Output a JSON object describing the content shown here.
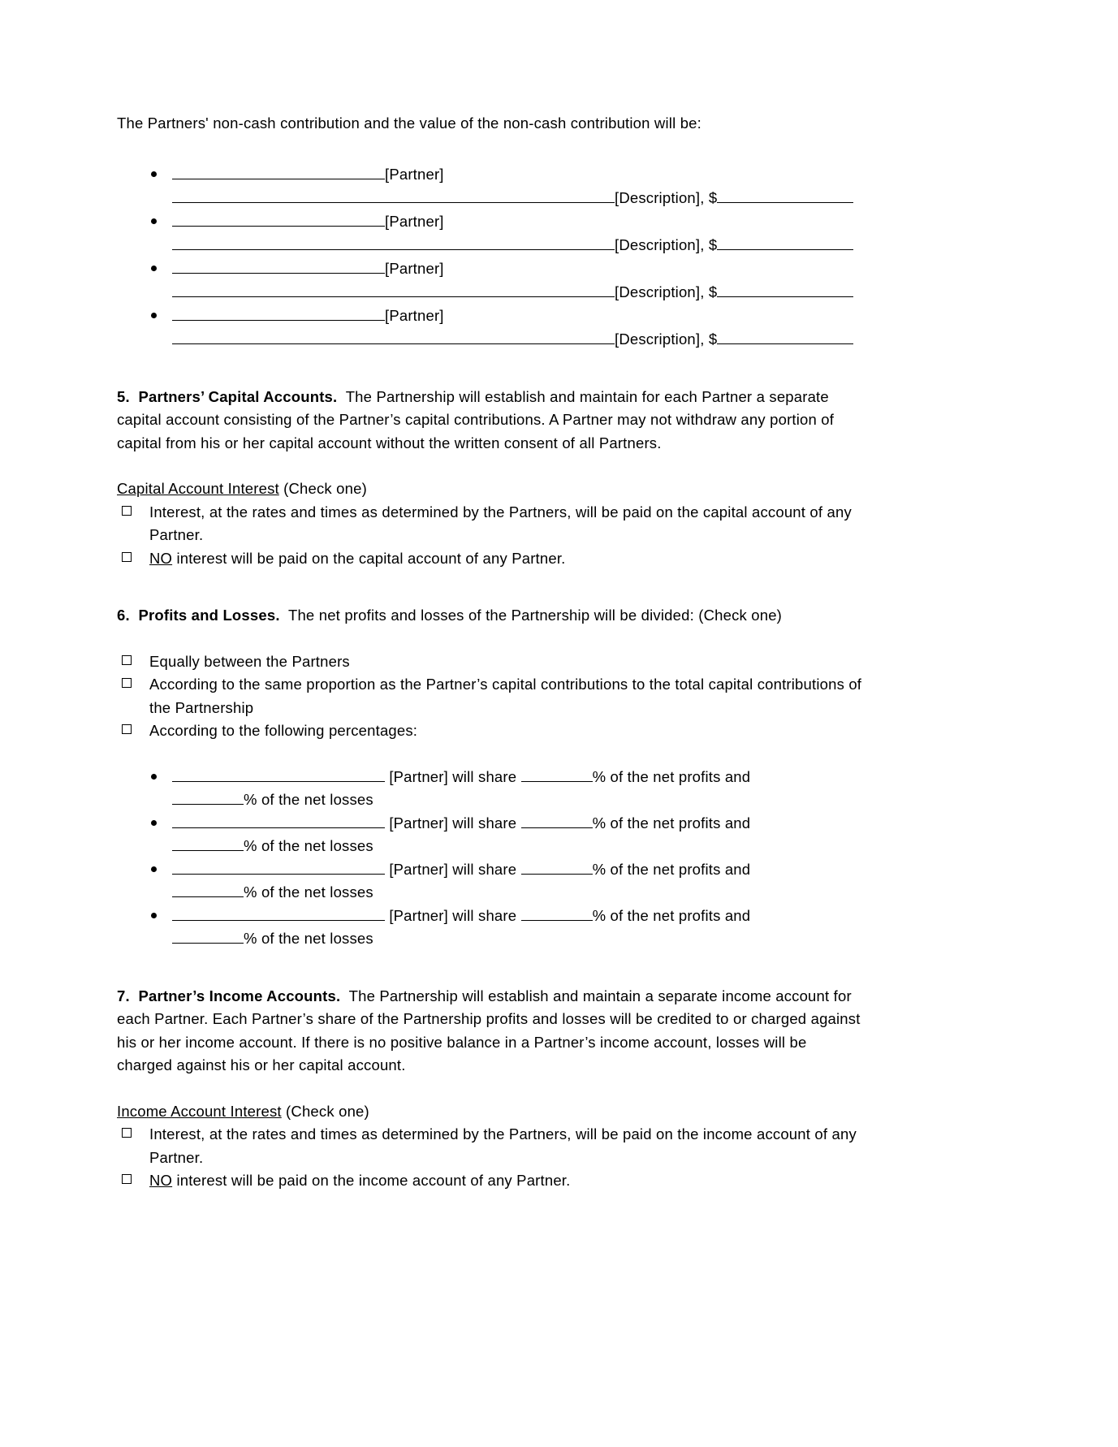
{
  "document": {
    "intro": "The Partners' non-cash contribution and the value of the non-cash contribution will be:",
    "contribution_entries": [
      {
        "partner_label": "[Partner]",
        "description_label": "[Description], $"
      },
      {
        "partner_label": "[Partner]",
        "description_label": "[Description], $"
      },
      {
        "partner_label": "[Partner]",
        "description_label": "[Description], $"
      },
      {
        "partner_label": "[Partner]",
        "description_label": "[Description], $"
      }
    ],
    "section5": {
      "number": "5.",
      "heading": "Partners’ Capital Accounts.",
      "body": "The Partnership will establish and maintain for each Partner a separate capital account consisting of the Partner’s capital contributions. A Partner may not withdraw any portion of capital from his or her capital account without the written consent of all Partners.",
      "interest_heading": "Capital Account Interest",
      "interest_heading_suffix": " (Check one)",
      "options": [
        {
          "text": "Interest, at the rates and times as determined by the Partners, will be paid on the capital account of any Partner.",
          "checked": false
        },
        {
          "emphasis": "NO",
          "text": " interest will be paid on the capital account of any Partner.",
          "checked": false
        }
      ]
    },
    "section6": {
      "number": "6.",
      "heading": "Profits and Losses.",
      "body": "The net profits and losses of the Partnership will be divided: (Check one)",
      "options": [
        {
          "text": "Equally between the Partners",
          "checked": false
        },
        {
          "text": "According to the same proportion as the Partner’s capital contributions to the total capital contributions of the Partnership",
          "checked": false
        },
        {
          "text": "According to the following percentages:",
          "checked": false
        }
      ],
      "percentage_entries": [
        {
          "partner_label": "[Partner] will share",
          "profits_suffix": "% of the net profits and",
          "losses_suffix": "% of the net losses"
        },
        {
          "partner_label": "[Partner] will share",
          "profits_suffix": "% of the net profits and",
          "losses_suffix": "% of the net losses"
        },
        {
          "partner_label": "[Partner] will share",
          "profits_suffix": "% of the net profits and",
          "losses_suffix": "% of the net losses"
        },
        {
          "partner_label": "[Partner] will share",
          "profits_suffix": "% of the net profits and",
          "losses_suffix": "% of the net losses"
        }
      ]
    },
    "section7": {
      "number": "7.",
      "heading": "Partner’s Income Accounts.",
      "body": "The Partnership will establish and maintain a separate income account for each Partner. Each Partner’s share of the Partnership profits and losses will be credited to or charged against his or her income account. If there is no positive balance in a Partner’s income account, losses will be charged against his or her capital account.",
      "interest_heading": "Income Account Interest",
      "interest_heading_suffix": " (Check one)",
      "options": [
        {
          "text": "Interest, at the rates and times as determined by the Partners, will be paid on the income account of any Partner.",
          "checked": false
        },
        {
          "emphasis": "NO",
          "text": " interest will be paid on the income account of any Partner.",
          "checked": false
        }
      ]
    }
  }
}
